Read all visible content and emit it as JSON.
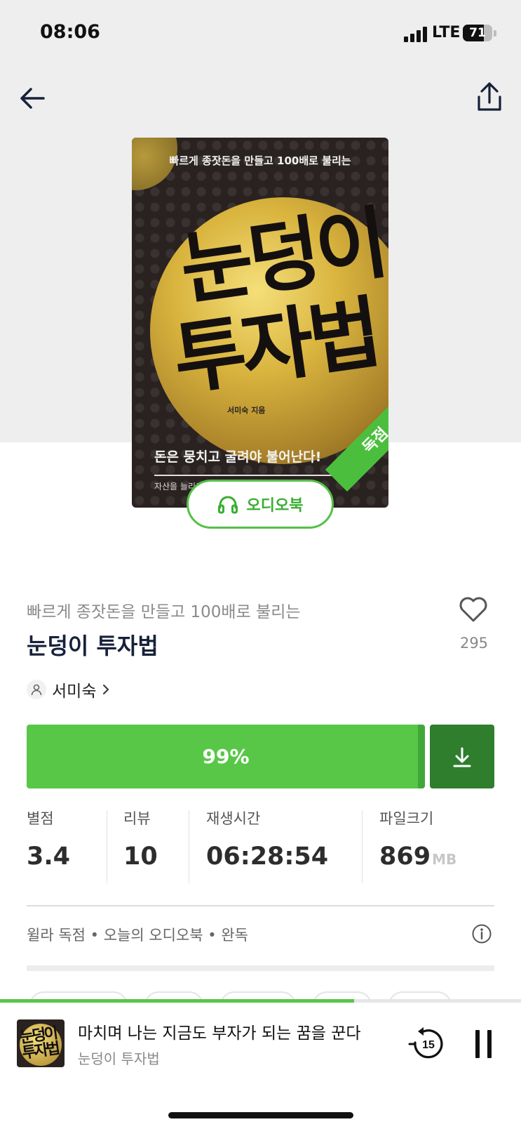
{
  "status_bar": {
    "time": "08:06",
    "network": "LTE",
    "battery_level": "71"
  },
  "header": {
    "back_icon": "arrow-left-icon",
    "share_icon": "share-icon"
  },
  "cover": {
    "subtitle": "빠르게 종잣돈을 만들고 100배로 불리는",
    "title_line1": "눈덩이",
    "title_line2": "투자법",
    "author_label": "서미숙 지음",
    "tagline": "돈은 뭉치고 굴려야 불어난다!",
    "small_text": "자산을 늘리고",
    "ribbon": "독점"
  },
  "audio_badge": {
    "icon": "headphones-icon",
    "label": "오디오북"
  },
  "book": {
    "subtitle": "빠르게 종잣돈을 만들고 100배로 불리는",
    "title": "눈덩이 투자법",
    "author": "서미숙",
    "like_count": "295"
  },
  "actions": {
    "progress_label": "99%",
    "progress_fraction": 0.99,
    "download_icon": "download-icon"
  },
  "stats": [
    {
      "label": "별점",
      "value": "3.4",
      "unit": ""
    },
    {
      "label": "리뷰",
      "value": "10",
      "unit": ""
    },
    {
      "label": "재생시간",
      "value": "06:28:54",
      "unit": ""
    },
    {
      "label": "파일크기",
      "value": "869",
      "unit": "MB"
    }
  ],
  "tags_line": "윌라 독점 • 오늘의 오디오북 • 완독",
  "mini_player": {
    "chapter_title": "마치며 나는 지금도 부자가 되는 꿈을 꾼다",
    "book_title": "눈덩이 투자법",
    "thumb_text": "눈덩이 투자법",
    "skip_seconds": "15",
    "progress_fraction": 0.68
  },
  "colors": {
    "accent": "#58c748",
    "accent_dark": "#2f7e2e",
    "title": "#17213a"
  }
}
